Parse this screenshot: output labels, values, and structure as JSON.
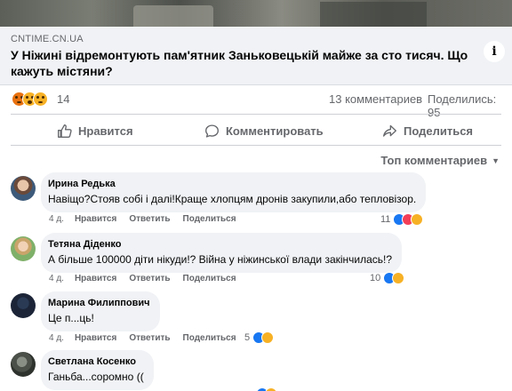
{
  "link_preview": {
    "domain": "CNTIME.CN.UA",
    "title": "У Ніжині відремонтують пам'ятник Заньковецькій майже за сто тисяч. Що кажуть містяни?",
    "info_icon": "info-icon"
  },
  "stats": {
    "reaction_icons": [
      "angry-reaction-icon",
      "wow-reaction-icon",
      "sad-reaction-icon"
    ],
    "reaction_count": "14",
    "comments": "13 комментариев",
    "shares": "Поделились: 95"
  },
  "actions": {
    "like": "Нравится",
    "comment": "Комментировать",
    "share": "Поделиться"
  },
  "sort": {
    "label": "Топ комментариев"
  },
  "comments": [
    {
      "author": "Ирина Редька",
      "text": "Навіщо?Стояв собі і далі!Краще хлопцям дронів закупили,або тепловізор.",
      "time": "4 д.",
      "like": "Нравится",
      "reply": "Ответить",
      "share": "Поделиться",
      "reactions": "11",
      "reaction_icons": [
        "like-icon",
        "love-icon",
        "care-icon"
      ]
    },
    {
      "author": "Тетяна Діденко",
      "text": "А більше 100000 діти нікуди!? Війна у ніжинської влади закінчилась!?",
      "time": "4 д.",
      "like": "Нравится",
      "reply": "Ответить",
      "share": "Поделиться",
      "reactions": "10",
      "reaction_icons": [
        "like-icon",
        "care-icon"
      ]
    },
    {
      "author": "Марина Филиппович",
      "text": "Це п...ць!",
      "time": "4 д.",
      "like": "Нравится",
      "reply": "Ответить",
      "share": "Поделиться",
      "reactions": "5",
      "reaction_icons": [
        "like-icon",
        "care-icon"
      ]
    },
    {
      "author": "Светлана Косенко",
      "text": "Ганьба...соромно ((",
      "time": "",
      "like": "",
      "reply": "",
      "share": "",
      "reactions": "",
      "reaction_icons": [
        "like-icon",
        "care-icon"
      ]
    }
  ],
  "colors": {
    "like_blue": "#1877f2",
    "love_red": "#f33e58",
    "care_yellow": "#f7b125",
    "angry_orange": "#e9710f",
    "bubble_bg": "#f0f2f5",
    "meta_gray": "#65676b"
  }
}
